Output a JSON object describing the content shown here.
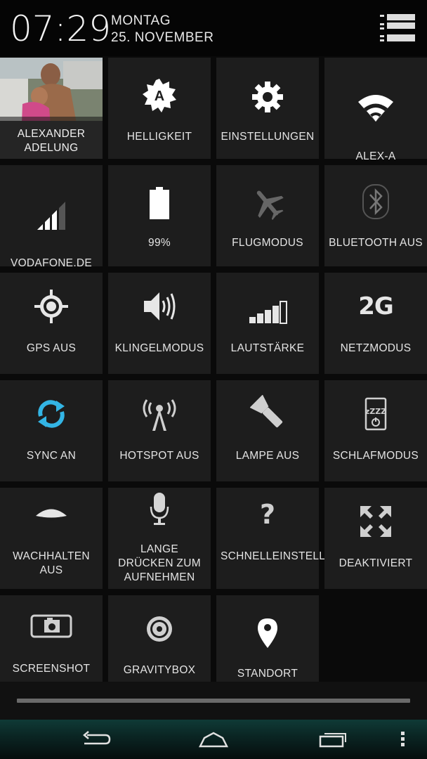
{
  "header": {
    "time": "07:29",
    "day": "MONTAG",
    "date": "25. NOVEMBER",
    "toggle_icon": "list-icon"
  },
  "tiles": [
    {
      "label": "ALEXANDER ADELUNG",
      "icon": "profile-photo"
    },
    {
      "label": "HELLIGKEIT",
      "icon": "brightness-auto-icon"
    },
    {
      "label": "EINSTELLUNGEN",
      "icon": "gear-icon"
    },
    {
      "label": "ALEX-A",
      "icon": "wifi-icon"
    },
    {
      "label": "VODAFONE.DE",
      "icon": "signal-icon"
    },
    {
      "label": "99%",
      "icon": "battery-icon"
    },
    {
      "label": "FLUGMODUS",
      "icon": "airplane-icon"
    },
    {
      "label": "BLUETOOTH AUS",
      "icon": "bluetooth-icon"
    },
    {
      "label": "GPS AUS",
      "icon": "gps-icon"
    },
    {
      "label": "KLINGELMODUS",
      "icon": "speaker-icon"
    },
    {
      "label": "LAUTSTÄRKE",
      "icon": "volume-bars-icon"
    },
    {
      "label": "NETZMODUS",
      "icon": "network-2g-icon",
      "icon_text": "2G"
    },
    {
      "label": "SYNC AN",
      "icon": "sync-icon"
    },
    {
      "label": "HOTSPOT AUS",
      "icon": "hotspot-icon"
    },
    {
      "label": "LAMPE AUS",
      "icon": "flashlight-icon"
    },
    {
      "label": "SCHLAFMODUS",
      "icon": "sleep-icon",
      "icon_text": "zZZZ"
    },
    {
      "label": "WACHHALTEN AUS",
      "icon": "eye-icon"
    },
    {
      "label": "LANGE DRÜCKEN ZUM AUFNEHMEN",
      "icon": "microphone-icon"
    },
    {
      "label": "SCHNELLEINSTELLUNGEN",
      "icon": "question-icon",
      "icon_text": "?"
    },
    {
      "label": "DEAKTIVIERT",
      "icon": "expand-icon"
    },
    {
      "label": "SCREENSHOT",
      "icon": "camera-icon"
    },
    {
      "label": "GRAVITYBOX",
      "icon": "gravitybox-icon"
    },
    {
      "label": "STANDORT",
      "icon": "location-pin-icon"
    }
  ],
  "navbar": {
    "back": "back-icon",
    "home": "home-icon",
    "recents": "recents-icon",
    "menu": "overflow-menu-icon"
  },
  "colors": {
    "tile_bg": "#1d1d1d",
    "sync_active": "#33b5e5",
    "icon_white": "#ffffff",
    "icon_dim": "#6b6b6b"
  }
}
